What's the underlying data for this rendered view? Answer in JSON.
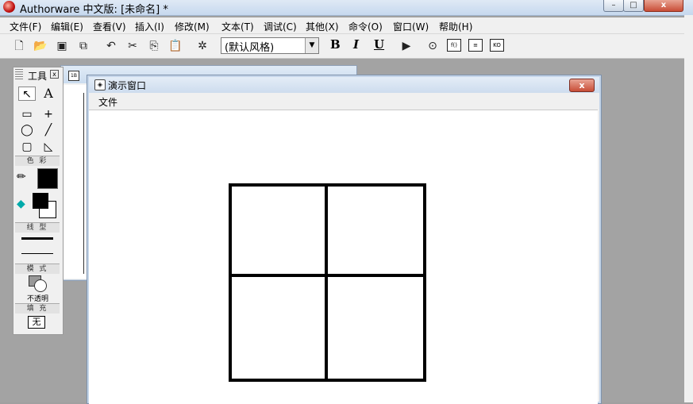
{
  "app": {
    "title": "Authorware 中文版: [未命名] *",
    "window_buttons": [
      "–",
      "□",
      "x"
    ]
  },
  "menu": [
    "文件(F)",
    "编辑(E)",
    "查看(V)",
    "插入(I)",
    "修改(M)",
    "文本(T)",
    "调试(C)",
    "其他(X)",
    "命令(O)",
    "窗口(W)",
    "帮助(H)"
  ],
  "toolbar": {
    "style_value": "(默认风格)",
    "bold": "B",
    "italic": "I",
    "underline": "U"
  },
  "tools": {
    "title": "工具",
    "pointer": "↖",
    "text_tool": "A",
    "color_label": "色 彩",
    "line_label": "线 型",
    "mode_label": "模 式",
    "mode_value": "不透明",
    "fill_label": "填 充",
    "fill_value": "无"
  },
  "presentation": {
    "title": "演示窗口",
    "menu_file": "文件",
    "close": "x"
  },
  "colors": {
    "titlebar": "#c6d8ee",
    "close_red": "#c84d37",
    "client_gray": "#a3a3a3",
    "grid_line": "#000000"
  }
}
